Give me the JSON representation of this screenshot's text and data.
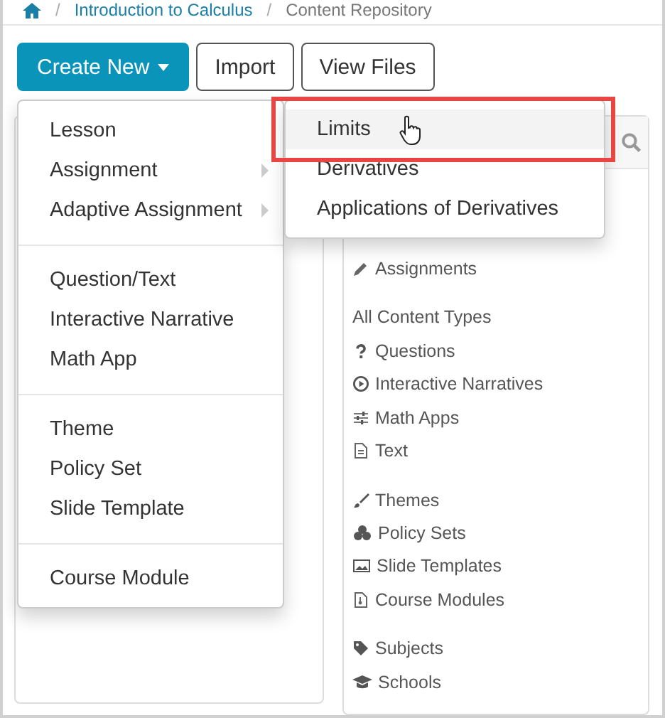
{
  "breadcrumb": {
    "separator": "/",
    "items": [
      {
        "label": "Introduction to Calculus",
        "kind": "link"
      },
      {
        "label": "Content Repository",
        "kind": "current"
      }
    ]
  },
  "toolbar": [
    {
      "label": "Create New",
      "kind": "primary"
    },
    {
      "label": "Import",
      "kind": "default"
    },
    {
      "label": "View Files",
      "kind": "default"
    }
  ],
  "create_menu": {
    "expanded": true,
    "groups": [
      [
        {
          "label": "Lesson",
          "has_submenu": false
        },
        {
          "label": "Assignment",
          "has_submenu": true
        },
        {
          "label": "Adaptive Assignment",
          "has_submenu": true
        }
      ],
      [
        {
          "label": "Question/Text",
          "has_submenu": false
        },
        {
          "label": "Interactive Narrative",
          "has_submenu": false
        },
        {
          "label": "Math App",
          "has_submenu": false
        }
      ],
      [
        {
          "label": "Theme",
          "has_submenu": false
        },
        {
          "label": "Policy Set",
          "has_submenu": false
        },
        {
          "label": "Slide Template",
          "has_submenu": false
        }
      ],
      [
        {
          "label": "Course Module",
          "has_submenu": false
        }
      ]
    ]
  },
  "submenu": {
    "items": [
      {
        "label": "Limits",
        "selected": true
      },
      {
        "label": "Derivatives",
        "selected": false
      },
      {
        "label": "Applications of Derivatives",
        "selected": false
      }
    ]
  },
  "sidebar": {
    "groups": [
      {
        "items": [
          "Assignments"
        ]
      },
      {
        "heading": "All Content Types",
        "items": [
          "Questions",
          "Interactive Narratives",
          "Math Apps",
          "Text"
        ]
      },
      {
        "items": [
          "Themes",
          "Policy Sets",
          "Slide Templates",
          "Course Modules"
        ]
      },
      {
        "items": [
          "Subjects",
          "Schools"
        ]
      }
    ]
  }
}
